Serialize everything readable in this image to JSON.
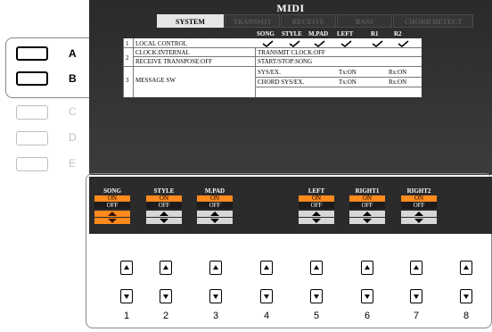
{
  "screen": {
    "title": "MIDI",
    "tabs": [
      {
        "label": "SYSTEM",
        "active": true
      },
      {
        "label": "TRANSMIT",
        "active": false
      },
      {
        "label": "RECEIVE",
        "active": false
      },
      {
        "label": "BASS",
        "active": false
      },
      {
        "label": "CHORD DETECT",
        "active": false
      }
    ],
    "columns": [
      "SONG",
      "STYLE",
      "M.PAD",
      "LEFT",
      "R1",
      "R2"
    ],
    "rows": {
      "r1_num": "1",
      "local_control": "LOCAL CONTROL",
      "r2_num": "2",
      "clock": "CLOCK:INTERNAL",
      "transmit_clock": "TRANSMIT CLOCK:OFF",
      "receive_transpose": "RECEIVE TRANSPOSE:OFF",
      "start_stop": "START/STOP:SONG",
      "r3_num": "3",
      "message_sw": "MESSAGE SW",
      "sysex": "SYS/EX.",
      "sysex_tx": "Tx:ON",
      "sysex_rx": "Rx:ON",
      "chord_sysex": "CHORD SYS/EX.",
      "chord_tx": "Tx:ON",
      "chord_rx": "Rx:ON"
    }
  },
  "page_buttons": [
    {
      "label": "A",
      "active": true
    },
    {
      "label": "B",
      "active": true
    },
    {
      "label": "C",
      "active": false
    },
    {
      "label": "D",
      "active": false
    },
    {
      "label": "E",
      "active": false
    }
  ],
  "channels": [
    {
      "label": "SONG",
      "on": "ON",
      "off": "OFF"
    },
    {
      "label": "STYLE",
      "on": "ON",
      "off": "OFF"
    },
    {
      "label": "M.PAD",
      "on": "ON",
      "off": "OFF"
    },
    {
      "label": "LEFT",
      "on": "ON",
      "off": "OFF"
    },
    {
      "label": "RIGHT1",
      "on": "ON",
      "off": "OFF"
    },
    {
      "label": "RIGHT2",
      "on": "ON",
      "off": "OFF"
    }
  ],
  "button_numbers": [
    "1",
    "2",
    "3",
    "4",
    "5",
    "6",
    "7",
    "8"
  ],
  "colors": {
    "accent": "#ff8a1e",
    "screen_bg": "#2a2a2a",
    "arrow_blue": "#2d4f82"
  }
}
